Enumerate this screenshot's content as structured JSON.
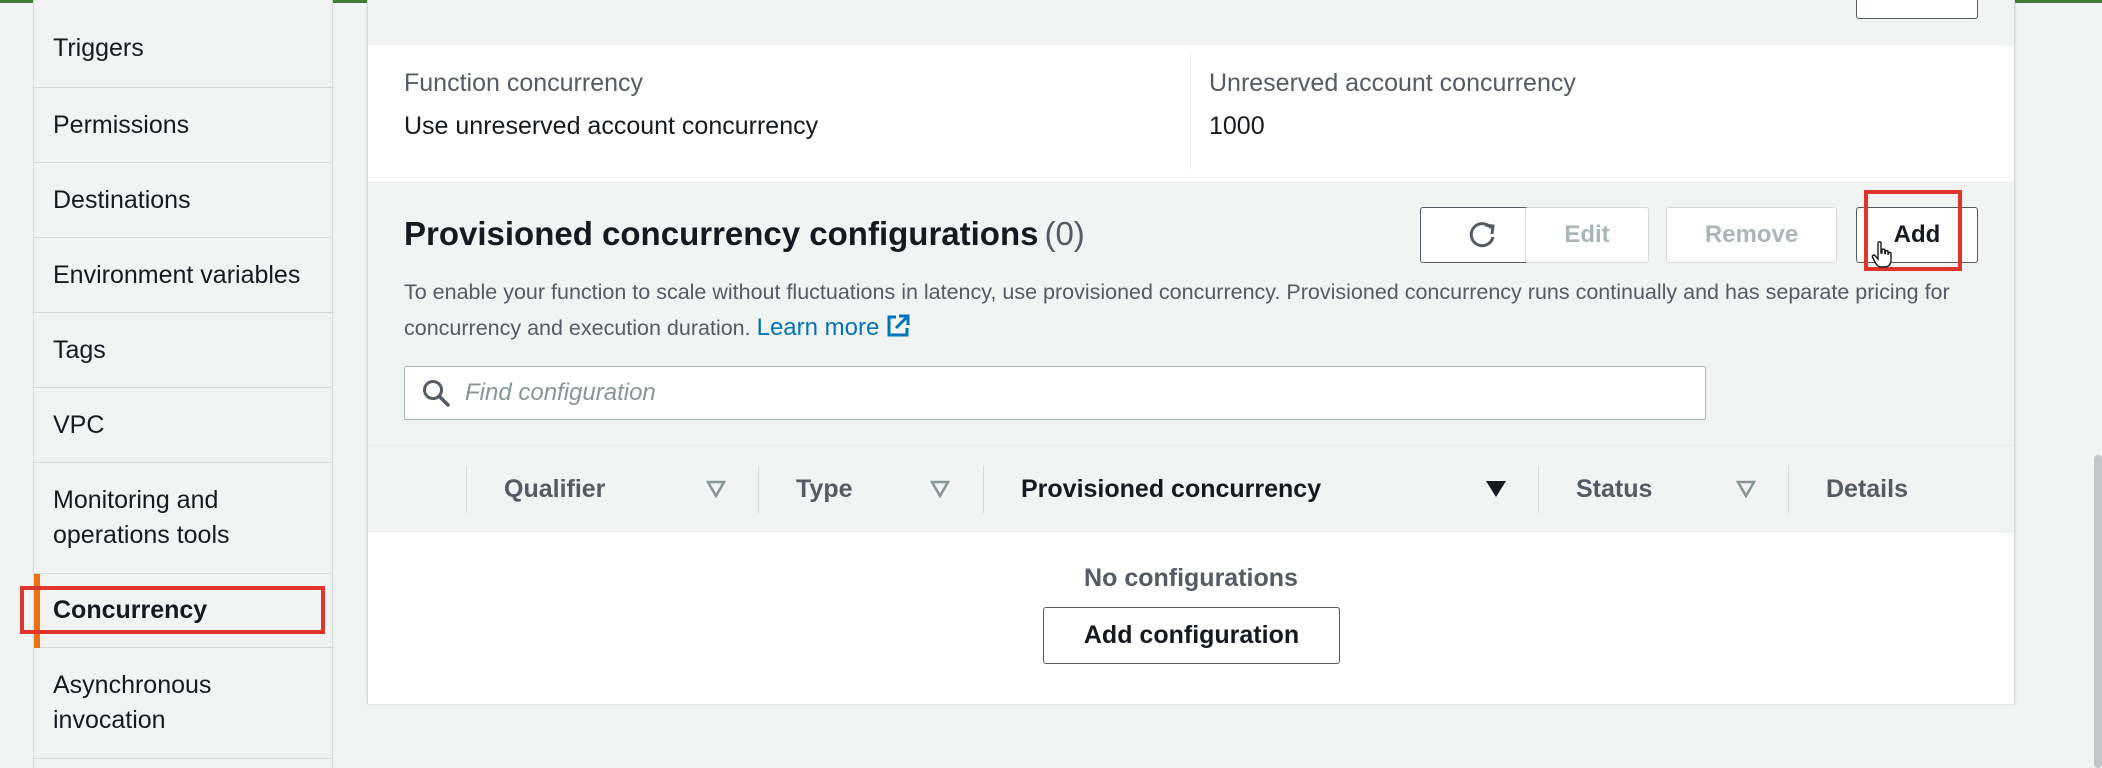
{
  "sidebar": {
    "items": [
      {
        "label": "Triggers"
      },
      {
        "label": "Permissions"
      },
      {
        "label": "Destinations"
      },
      {
        "label": "Environment variables"
      },
      {
        "label": "Tags"
      },
      {
        "label": "VPC"
      },
      {
        "label": "Monitoring and operations tools"
      },
      {
        "label": "Concurrency"
      },
      {
        "label": "Asynchronous invocation"
      }
    ],
    "active": "Concurrency"
  },
  "concurrency": {
    "function_concurrency_label": "Function concurrency",
    "function_concurrency_value": "Use unreserved account concurrency",
    "unreserved_label": "Unreserved account concurrency",
    "unreserved_value": "1000"
  },
  "provisioned": {
    "title": "Provisioned concurrency configurations",
    "count": "(0)",
    "buttons": {
      "refresh": "refresh-icon",
      "edit": "Edit",
      "remove": "Remove",
      "add": "Add"
    },
    "description": "To enable your function to scale without fluctuations in latency, use provisioned concurrency. Provisioned concurrency runs continually and has separate pricing for concurrency and execution duration.",
    "learn_more": "Learn more",
    "search_placeholder": "Find configuration",
    "columns": [
      "Qualifier",
      "Type",
      "Provisioned concurrency",
      "Status",
      "Details"
    ],
    "empty_text": "No configurations",
    "add_configuration": "Add configuration"
  },
  "colors": {
    "accent": "#ec7211",
    "highlight": "#e0352b",
    "link": "#0073bb"
  }
}
